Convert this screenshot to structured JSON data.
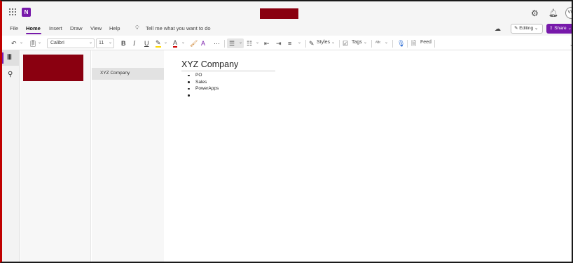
{
  "menu": {
    "file": "File",
    "home": "Home",
    "insert": "Insert",
    "draw": "Draw",
    "view": "View",
    "help": "Help",
    "tell_me": "Tell me what you want to do"
  },
  "header": {
    "avatar_initials": "VW",
    "editing_label": "Editing",
    "share_label": "Share"
  },
  "ribbon": {
    "font_name": "Calibri",
    "font_size": "11",
    "bold": "B",
    "italic": "I",
    "underline": "U",
    "styles_label": "Styles",
    "tags_label": "Tags",
    "feed_label": "Feed"
  },
  "pages": {
    "selected_page": "XYZ Company"
  },
  "note": {
    "title": "XYZ Company",
    "bullets": [
      "PO",
      "Sales",
      "PowerApps",
      ""
    ]
  },
  "colors": {
    "accent": "#7719aa",
    "redaction": "#8a0010",
    "highlight": "#ffd800",
    "font_color": "#d00000"
  }
}
